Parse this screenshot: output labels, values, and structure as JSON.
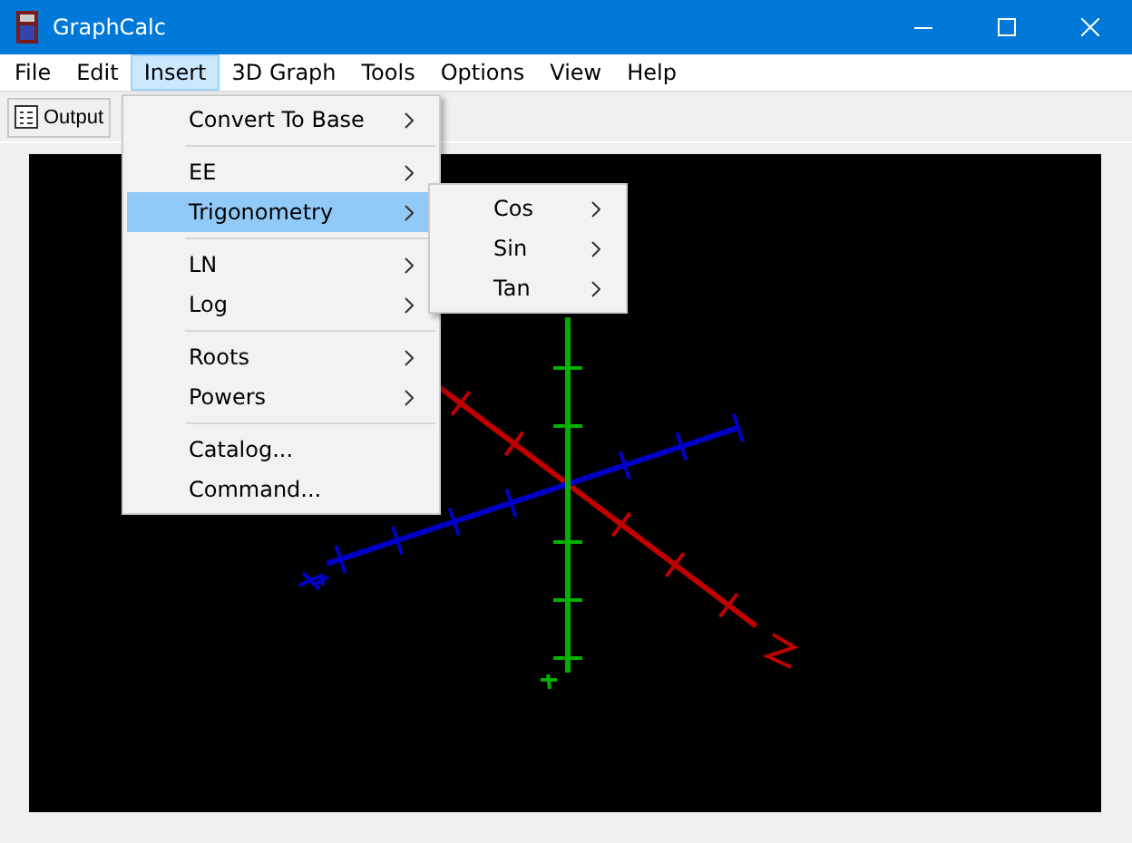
{
  "window": {
    "title": "GraphCalc"
  },
  "menu_bar": [
    {
      "label": "File",
      "selected": false
    },
    {
      "label": "Edit",
      "selected": false
    },
    {
      "label": "Insert",
      "selected": true
    },
    {
      "label": "3D Graph",
      "selected": false
    },
    {
      "label": "Tools",
      "selected": false
    },
    {
      "label": "Options",
      "selected": false
    },
    {
      "label": "View",
      "selected": false
    },
    {
      "label": "Help",
      "selected": false
    }
  ],
  "toolbar": {
    "output_button": "Output"
  },
  "insert_menu": [
    {
      "kind": "item",
      "label": "Convert To Base",
      "submenu": true,
      "selected": false
    },
    {
      "kind": "separator"
    },
    {
      "kind": "item",
      "label": "EE",
      "submenu": true,
      "selected": false
    },
    {
      "kind": "item",
      "label": "Trigonometry",
      "submenu": true,
      "selected": true
    },
    {
      "kind": "separator"
    },
    {
      "kind": "item",
      "label": "LN",
      "submenu": true,
      "selected": false
    },
    {
      "kind": "item",
      "label": "Log",
      "submenu": true,
      "selected": false
    },
    {
      "kind": "separator"
    },
    {
      "kind": "item",
      "label": "Roots",
      "submenu": true,
      "selected": false
    },
    {
      "kind": "item",
      "label": "Powers",
      "submenu": true,
      "selected": false
    },
    {
      "kind": "separator"
    },
    {
      "kind": "item",
      "label": "Catalog...",
      "submenu": false,
      "selected": false
    },
    {
      "kind": "item",
      "label": "Command...",
      "submenu": false,
      "selected": false
    }
  ],
  "trigonometry_submenu": [
    {
      "label": "Cos",
      "submenu": true,
      "selected": false
    },
    {
      "label": "Sin",
      "submenu": true,
      "selected": false
    },
    {
      "label": "Tan",
      "submenu": true,
      "selected": false
    }
  ]
}
